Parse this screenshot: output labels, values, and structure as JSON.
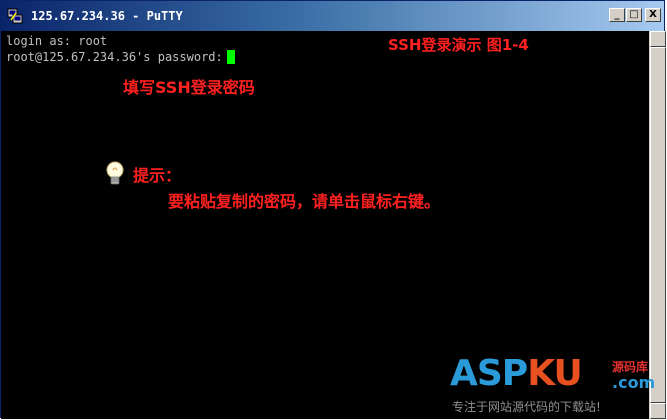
{
  "window": {
    "title": "125.67.234.36 - PuTTY",
    "buttons": {
      "minimize": "_",
      "maximize": "□",
      "close": "X"
    }
  },
  "terminal": {
    "lines": [
      "login as: root",
      "root@125.67.234.36's password:"
    ],
    "cursor_color": "#00ff00",
    "text_color": "#c0c0c0"
  },
  "annotations": {
    "figure_title": "SSH登录演示 图1-4",
    "password_hint": "填写SSH登录密码",
    "tip_label": "提示：",
    "tip_text": "要粘贴复制的密码，请单击鼠标右键。",
    "color": "#ff2020"
  },
  "watermark": {
    "logo_left": "ASP",
    "logo_right": "KU",
    "logo_sub": "源码库",
    "logo_domain": ".com",
    "slogan": "专注于网站源代码的下载站!"
  }
}
